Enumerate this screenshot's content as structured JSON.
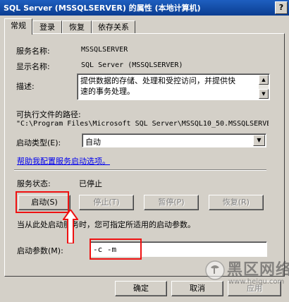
{
  "window": {
    "title": "SQL Server (MSSQLSERVER) 的属性 (本地计算机)",
    "help_glyph": "?"
  },
  "tabs": [
    {
      "label": "常规"
    },
    {
      "label": "登录"
    },
    {
      "label": "恢复"
    },
    {
      "label": "依存关系"
    }
  ],
  "general": {
    "service_name_label": "服务名称:",
    "service_name_value": "MSSQLSERVER",
    "display_name_label": "显示名称:",
    "display_name_value": "SQL Server (MSSQLSERVER)",
    "description_label": "描述:",
    "description_value": "提供数据的存储、处理和受控访问，并提供快速的事务处理。",
    "exe_path_label": "可执行文件的路径:",
    "exe_path_value": "\"C:\\Program Files\\Microsoft SQL Server\\MSSQL10_50.MSSQLSERVE",
    "startup_type_label": "启动类型(E):",
    "startup_type_value": "自动",
    "help_link": "帮助我配置服务启动选项。",
    "service_status_label": "服务状态:",
    "service_status_value": "已停止"
  },
  "buttons": {
    "start": "启动(S)",
    "stop": "停止(T)",
    "pause": "暂停(P)",
    "resume": "恢复(R)"
  },
  "hint_text": "当从此处启动服务时，您可指定所适用的启动参数。",
  "start_params": {
    "label": "启动参数(M):",
    "value": "-c -m"
  },
  "dialog_buttons": {
    "ok": "确定",
    "cancel": "取消",
    "apply": "应用"
  },
  "watermark": {
    "text": "黑区网络",
    "url": "www.heiqu.com"
  },
  "colors": {
    "annotation_red": "#e11111",
    "titlebar": "#0b3d91",
    "link": "#0000ee"
  }
}
